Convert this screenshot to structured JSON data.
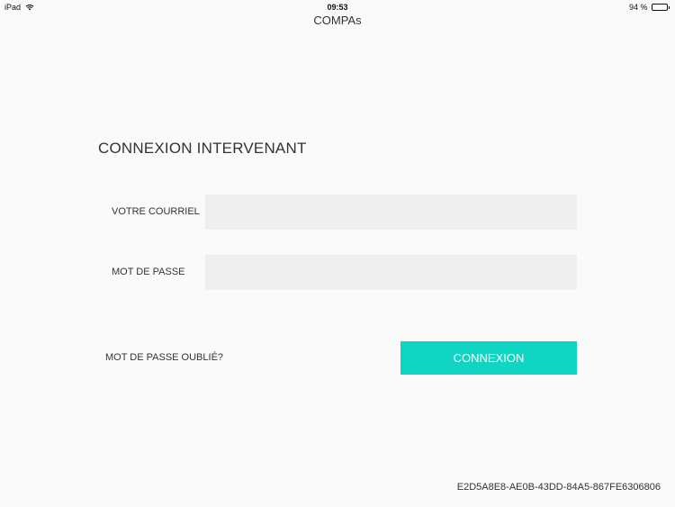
{
  "status_bar": {
    "device": "iPad",
    "time": "09:53",
    "battery_text": "94 %",
    "battery_level": 0.94,
    "icons": [
      "wifi-icon",
      "battery-icon"
    ]
  },
  "nav": {
    "title": "COMPAs"
  },
  "login_form": {
    "title": "CONNEXION INTERVENANT",
    "email_label": "VOTRE COURRIEL",
    "email_value": "",
    "password_label": "MOT DE PASSE",
    "password_value": "",
    "forgot_password": "MOT DE PASSE OUBLIÉ?",
    "submit_label": "CONNEXION"
  },
  "footer": {
    "device_id": "E2D5A8E8-AE0B-43DD-84A5-867FE6306806"
  },
  "colors": {
    "accent": "#10d5c3",
    "input_bg": "#efefef",
    "background": "#fafafa",
    "text": "#333333"
  }
}
